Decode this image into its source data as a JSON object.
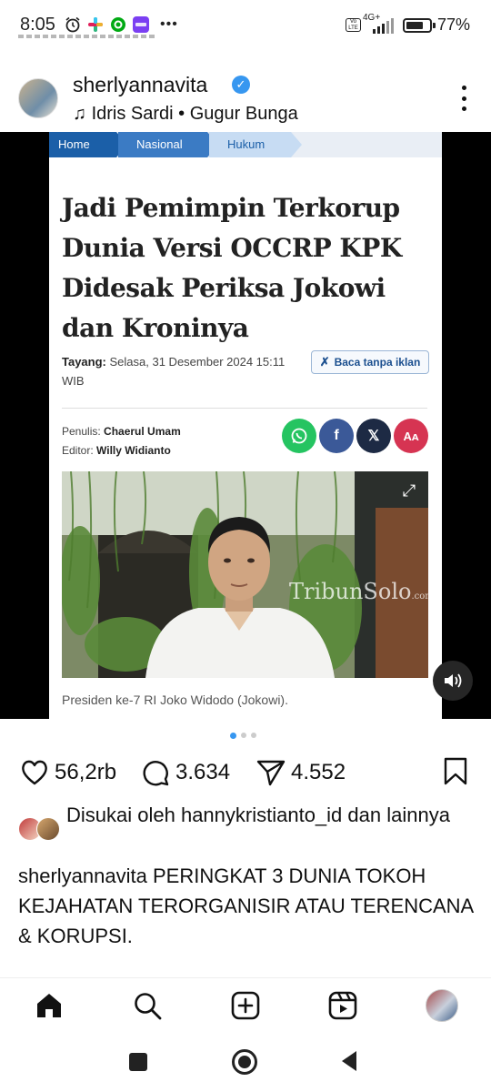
{
  "status_bar": {
    "time": "8:05",
    "network_label": "4G+",
    "volte_label": "Vo LTE",
    "battery_percent": "77%",
    "battery_level": 0.77,
    "overflow_label": "•••"
  },
  "post": {
    "username": "sherlyannavita",
    "verified_glyph": "✓",
    "music_artist": "Idris Sardi",
    "music_separator": "•",
    "music_title": "Gugur Bunga"
  },
  "article": {
    "breadcrumbs": [
      "Home",
      "Nasional",
      "Hukum"
    ],
    "headline": "Jadi Pemimpin Terkorup Dunia Versi OCCRP KPK Didesak Periksa Jokowi dan Kroninya",
    "tayang_label": "Tayang:",
    "tayang_value": "Selasa, 31 Desember 2024 15:11 WIB",
    "no_ads_label": "Baca tanpa iklan",
    "writer_label": "Penulis:",
    "writer_name": "Chaerul Umam",
    "editor_label": "Editor:",
    "editor_name": "Willy Widianto",
    "share_buttons": [
      {
        "name": "whatsapp",
        "glyph": "✆",
        "color": "#25c461"
      },
      {
        "name": "facebook",
        "glyph": "f",
        "color": "#3b5998"
      },
      {
        "name": "x",
        "glyph": "𝕏",
        "color": "#1d2a44"
      },
      {
        "name": "font-size",
        "glyph": "Aᴀ",
        "color": "#d63452"
      }
    ],
    "watermark": "TribunSolo",
    "watermark_suffix": ".com",
    "photo_caption": "Presiden ke-7 RI Joko Widodo (Jokowi)."
  },
  "carousel": {
    "count": 3,
    "active": 0
  },
  "actions": {
    "likes": "56,2rb",
    "comments": "3.634",
    "shares": "4.552"
  },
  "liked_by": {
    "text": "Disukai oleh hannykristianto_id dan lainnya"
  },
  "caption": {
    "text": "sherlyannavita PERINGKAT 3 DUNIA TOKOH KEJAHATAN TERORGANISIR ATAU TERENCANA & KORUPSI."
  },
  "colors": {
    "accent_blue": "#3797f0",
    "tribun_blue": "#1b5fa8"
  }
}
